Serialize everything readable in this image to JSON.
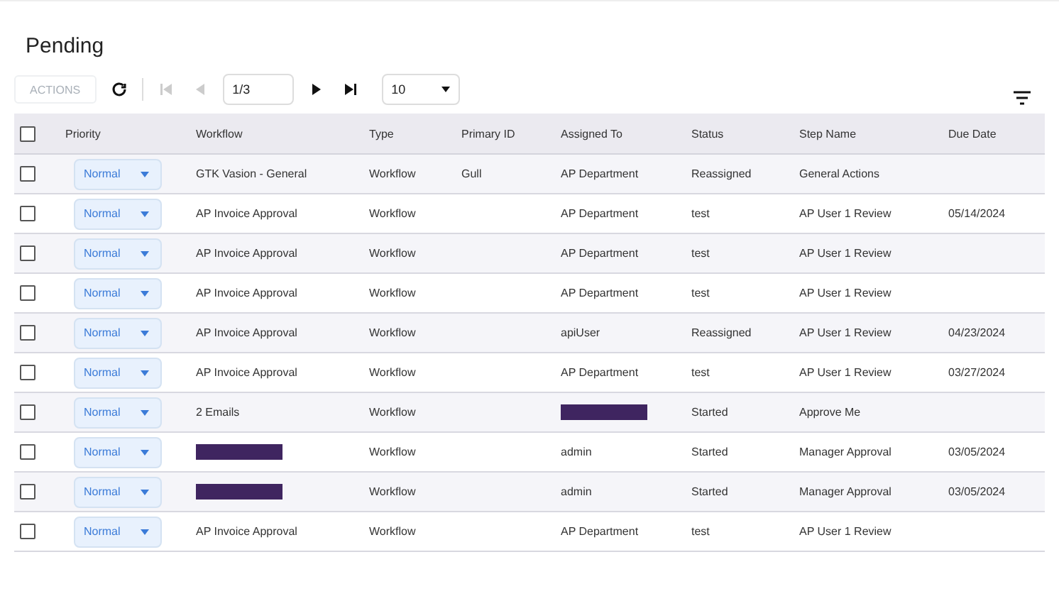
{
  "title": "Pending",
  "toolbar": {
    "actions_button": {
      "label": "ACTIONS",
      "disabled": true
    },
    "first_disabled": true,
    "prev_disabled": true,
    "next_disabled": false,
    "last_disabled": false,
    "page": "1/3",
    "page_size": "10"
  },
  "table": {
    "select_all_checked": false,
    "columns": [
      "Priority",
      "Workflow",
      "Type",
      "Primary ID",
      "Assigned To",
      "Status",
      "Step Name",
      "Due Date"
    ],
    "rows": [
      {
        "checked": false,
        "cells": [
          {
            "kind": "select",
            "text": "Normal"
          },
          {
            "kind": "text",
            "text": "GTK Vasion - General"
          },
          {
            "kind": "text",
            "text": "Workflow"
          },
          {
            "kind": "text",
            "text": "Gull"
          },
          {
            "kind": "text",
            "text": "AP Department"
          },
          {
            "kind": "text",
            "text": "Reassigned"
          },
          {
            "kind": "text",
            "text": "General Actions"
          },
          {
            "kind": "empty"
          }
        ]
      },
      {
        "checked": false,
        "cells": [
          {
            "kind": "select",
            "text": "Normal"
          },
          {
            "kind": "text",
            "text": "AP Invoice Approval"
          },
          {
            "kind": "text",
            "text": "Workflow"
          },
          {
            "kind": "empty"
          },
          {
            "kind": "text",
            "text": "AP Department"
          },
          {
            "kind": "text",
            "text": "test"
          },
          {
            "kind": "text",
            "text": "AP User 1 Review"
          },
          {
            "kind": "text",
            "text": "05/14/2024"
          }
        ]
      },
      {
        "checked": false,
        "cells": [
          {
            "kind": "select",
            "text": "Normal"
          },
          {
            "kind": "text",
            "text": "AP Invoice Approval"
          },
          {
            "kind": "text",
            "text": "Workflow"
          },
          {
            "kind": "empty"
          },
          {
            "kind": "text",
            "text": "AP Department"
          },
          {
            "kind": "text",
            "text": "test"
          },
          {
            "kind": "text",
            "text": "AP User 1 Review"
          },
          {
            "kind": "empty"
          }
        ]
      },
      {
        "checked": false,
        "cells": [
          {
            "kind": "select",
            "text": "Normal"
          },
          {
            "kind": "text",
            "text": "AP Invoice Approval"
          },
          {
            "kind": "text",
            "text": "Workflow"
          },
          {
            "kind": "empty"
          },
          {
            "kind": "text",
            "text": "AP Department"
          },
          {
            "kind": "text",
            "text": "test"
          },
          {
            "kind": "text",
            "text": "AP User 1 Review"
          },
          {
            "kind": "empty"
          }
        ]
      },
      {
        "checked": false,
        "cells": [
          {
            "kind": "select",
            "text": "Normal"
          },
          {
            "kind": "text",
            "text": "AP Invoice Approval"
          },
          {
            "kind": "text",
            "text": "Workflow"
          },
          {
            "kind": "empty"
          },
          {
            "kind": "text",
            "text": "apiUser"
          },
          {
            "kind": "text",
            "text": "Reassigned"
          },
          {
            "kind": "text",
            "text": "AP User 1 Review"
          },
          {
            "kind": "text",
            "text": "04/23/2024"
          }
        ]
      },
      {
        "checked": false,
        "cells": [
          {
            "kind": "select",
            "text": "Normal"
          },
          {
            "kind": "text",
            "text": "AP Invoice Approval"
          },
          {
            "kind": "text",
            "text": "Workflow"
          },
          {
            "kind": "empty"
          },
          {
            "kind": "text",
            "text": "AP Department"
          },
          {
            "kind": "text",
            "text": "test"
          },
          {
            "kind": "text",
            "text": "AP User 1 Review"
          },
          {
            "kind": "text",
            "text": "03/27/2024"
          }
        ]
      },
      {
        "checked": false,
        "cells": [
          {
            "kind": "select",
            "text": "Normal"
          },
          {
            "kind": "text",
            "text": "2 Emails"
          },
          {
            "kind": "text",
            "text": "Workflow"
          },
          {
            "kind": "empty"
          },
          {
            "kind": "redacted"
          },
          {
            "kind": "text",
            "text": "Started"
          },
          {
            "kind": "text",
            "text": "Approve Me"
          },
          {
            "kind": "empty"
          }
        ]
      },
      {
        "checked": false,
        "cells": [
          {
            "kind": "select",
            "text": "Normal"
          },
          {
            "kind": "redacted"
          },
          {
            "kind": "text",
            "text": "Workflow"
          },
          {
            "kind": "empty"
          },
          {
            "kind": "text",
            "text": "admin"
          },
          {
            "kind": "text",
            "text": "Started"
          },
          {
            "kind": "text",
            "text": "Manager Approval"
          },
          {
            "kind": "text",
            "text": "03/05/2024"
          }
        ]
      },
      {
        "checked": false,
        "cells": [
          {
            "kind": "select",
            "text": "Normal"
          },
          {
            "kind": "redacted"
          },
          {
            "kind": "text",
            "text": "Workflow"
          },
          {
            "kind": "empty"
          },
          {
            "kind": "text",
            "text": "admin"
          },
          {
            "kind": "text",
            "text": "Started"
          },
          {
            "kind": "text",
            "text": "Manager Approval"
          },
          {
            "kind": "text",
            "text": "03/05/2024"
          }
        ]
      },
      {
        "checked": false,
        "cells": [
          {
            "kind": "select",
            "text": "Normal"
          },
          {
            "kind": "text",
            "text": "AP Invoice Approval"
          },
          {
            "kind": "text",
            "text": "Workflow"
          },
          {
            "kind": "empty"
          },
          {
            "kind": "text",
            "text": "AP Department"
          },
          {
            "kind": "text",
            "text": "test"
          },
          {
            "kind": "text",
            "text": "AP User 1 Review"
          },
          {
            "kind": "empty"
          }
        ]
      }
    ]
  }
}
